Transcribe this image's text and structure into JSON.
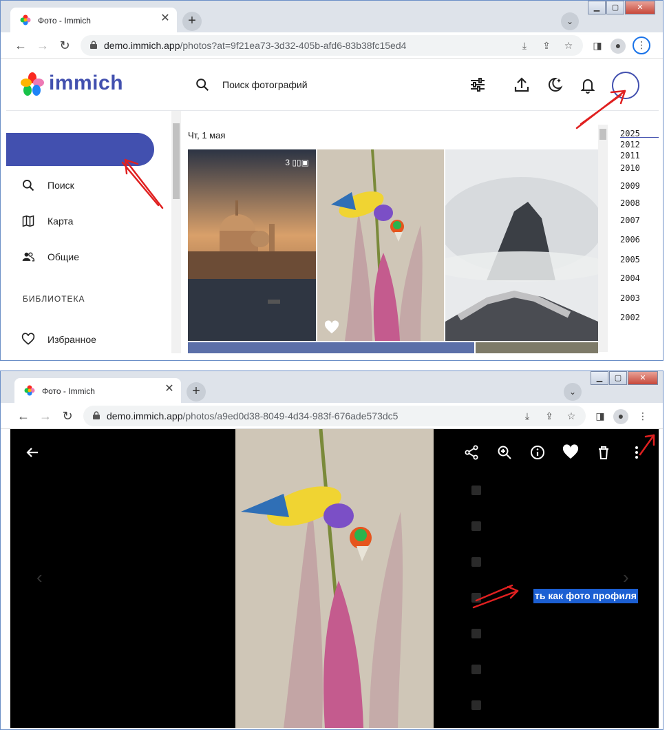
{
  "top": {
    "tab_title": "Фото - Immich",
    "url_host": "demo.immich.app",
    "url_path": "/photos?at=9f21ea73-3d32-405b-afd6-83b38fc15ed4",
    "logo_text": "immich",
    "search_placeholder": "Поиск фотографий",
    "sidebar": {
      "items": [
        {
          "label": "Поиск",
          "icon": "search-icon"
        },
        {
          "label": "Карта",
          "icon": "map-icon"
        },
        {
          "label": "Общие",
          "icon": "people-icon"
        }
      ],
      "section_label": "БИБЛИОТЕКА",
      "library_items": [
        {
          "label": "Избранное",
          "icon": "heart-outline-icon"
        }
      ]
    },
    "date_group": "Чт, 1 мая",
    "stack_badge": "3",
    "years": [
      "2025",
      "2012",
      "2011",
      "2010",
      "2009",
      "2008",
      "2007",
      "2006",
      "2005",
      "2004",
      "2003",
      "2002"
    ]
  },
  "bottom": {
    "tab_title": "Фото - Immich",
    "url_host": "demo.immich.app",
    "url_path": "/photos/a9ed0d38-8049-4d34-983f-676ade573dc5",
    "highlighted_menu_item": "ть как фото профиля"
  },
  "colors": {
    "brand": "#4250af",
    "annotation_arrow": "#e02020",
    "highlight": "#1c5fd2"
  }
}
